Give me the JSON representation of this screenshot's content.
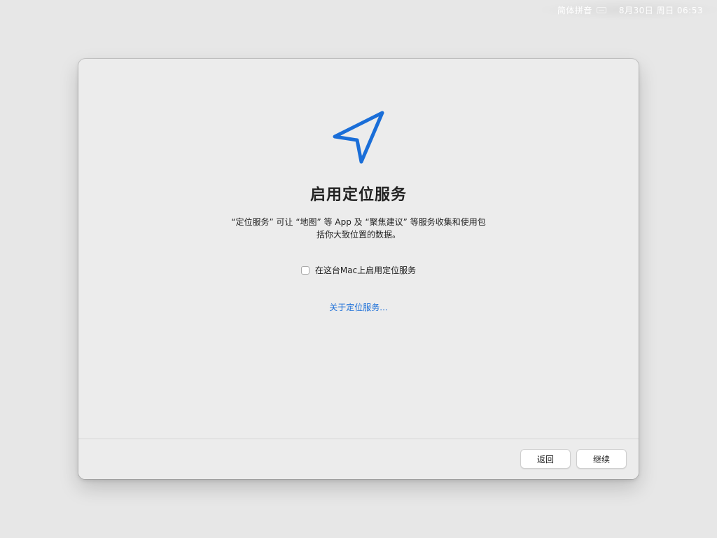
{
  "menubar": {
    "input_method": "简体拼音",
    "keyboard_icon": "keyboard-icon",
    "clock": "8月30日 周日 06:53"
  },
  "setup": {
    "icon": "location-arrow-icon",
    "accent_color": "#1a6ed8",
    "title": "启用定位服务",
    "description_line1": "“定位服务” 可让 “地图” 等 App 及 “聚焦建议” 等服务收集和使用包",
    "description_line2": "括你大致位置的数据。",
    "checkbox_label": "在这台Mac上启用定位服务",
    "checkbox_checked": false,
    "about_link": "关于定位服务..."
  },
  "footer": {
    "back_label": "返回",
    "continue_label": "继续"
  }
}
